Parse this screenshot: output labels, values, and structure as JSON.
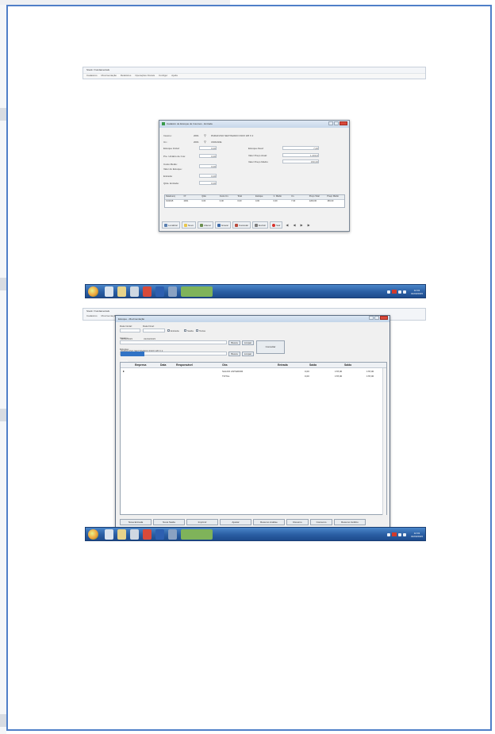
{
  "screen1": {
    "app_title": "Stock / Fundamentals",
    "menu": [
      "Cadastros",
      "Movimentação",
      "Relatórios",
      "Operações Fiscais",
      "Configur",
      "Ajuda"
    ],
    "dialog": {
      "title": "Cadastro de Estoque de Insumos - Entrada",
      "fields_left": [
        {
          "label": "Insumo:",
          "value": "2001"
        },
        {
          "label": "Un.:",
          "value": "2001"
        },
        {
          "label": "Estoque Inicial:",
          "value": "0,00"
        },
        {
          "label": "Pre. Unitário de Cus:",
          "value": "0,00"
        },
        {
          "label": "Custo Médio:",
          "value": "0,00"
        },
        {
          "label": "Valor do Estoque:",
          "value": "0,00"
        },
        {
          "label": "Entrada:",
          "value": "0,00"
        },
        {
          "label": "Qtde. Entrada:",
          "value": "0,00"
        }
      ],
      "insumo_desc": "PARAFUSO SEXTAVADO INOX 3/8 X 2",
      "un_desc": "UNIDADE",
      "fields_right": [
        {
          "label": "Estoque Atual:",
          "value": "7,00"
        },
        {
          "label": "Valor Preço Atual:",
          "value": "1.200,0"
        },
        {
          "label": "Valor Preço Médio:",
          "value": "150,00"
        }
      ],
      "grid_headers": [
        "Data/Lanç.",
        "Nº",
        "Qtde",
        "Custo Un.",
        "Total",
        "Estoque",
        "C. Médio",
        "Un.",
        "Preço Total",
        "Preço Médio"
      ],
      "grid_row": [
        "01/2015",
        "2001",
        "0,00",
        "0,00",
        "0,00",
        "0,00",
        "0,00",
        "7,00",
        "1200,00",
        "150,00"
      ],
      "toolbar": [
        "Localizar",
        "Novo",
        "Alterar",
        "Gravar",
        "Cancelar",
        "Excluir",
        "Sair"
      ]
    }
  },
  "taskbar": {
    "clock_time": "12:01",
    "clock_date": "01/03/2015"
  },
  "screen2": {
    "app_title": "Stock / Fundamentals",
    "menu": [
      "Cadastros",
      "Movimentação"
    ],
    "window": {
      "title": "Estoque - Movimentação",
      "date_from_label": "Data Inicial:",
      "date_from": "01/01/2015",
      "date_to_label": "Data Final:",
      "date_to": "31/03/2015",
      "checks": [
        "Entrada",
        "Saída",
        "Todos"
      ],
      "insumo_label": "Insumo:",
      "insumo_value": "PARAFUSO SEXTAVADO INOX 3/8 X 2",
      "busca_btn": "Busca",
      "limpar_btn": "Limpar",
      "consultar_btn": "Consultar",
      "estoque_label": "Estoque:",
      "estoque_value": "GERAL",
      "grid_headers": [
        "Empresa",
        "Data",
        "Responsável",
        "Obs",
        "Entrada",
        "Saída",
        "Saldo"
      ],
      "rows": [
        {
          "obs": "SALDO ANTERIOR",
          "entrada": "0,00",
          "saida": "178,00",
          "saldo": "178,00"
        },
        {
          "obs": "TOTAL",
          "entrada": "0,00",
          "saida": "178,00",
          "saldo": "178,00"
        }
      ],
      "bottom_tabs": [
        "Nova Entrada",
        "Nova Saída",
        "Imprimir",
        "Ajustar",
        "Resumo Análise",
        "Resumo",
        "Consumo",
        "Resumo Gráfico"
      ]
    }
  }
}
